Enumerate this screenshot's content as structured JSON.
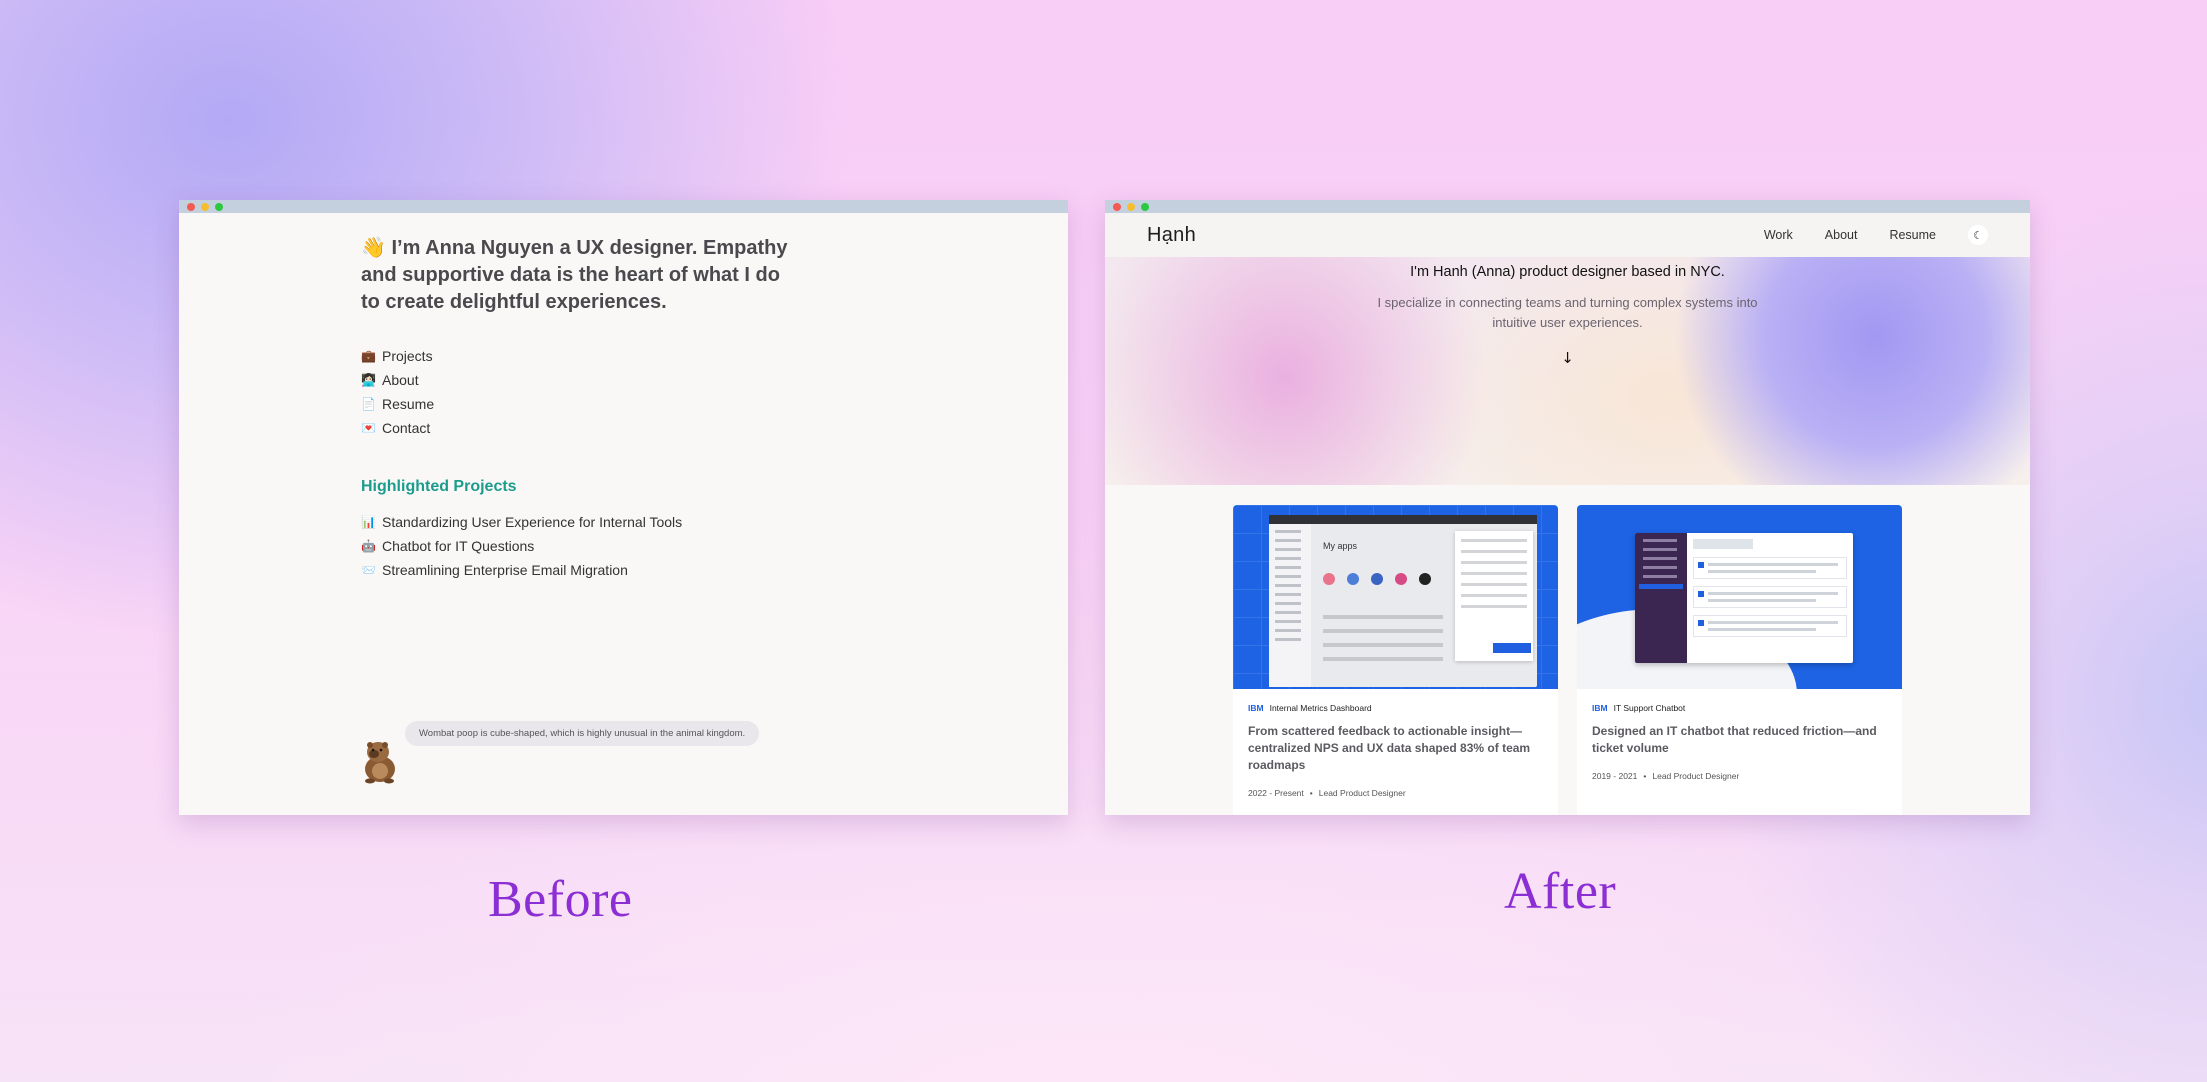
{
  "before": {
    "hero_emoji": "👋",
    "hero_text": "I’m Anna Nguyen a UX designer. Empathy and supportive data is the heart of what I do to create delightful experiences.",
    "nav": [
      {
        "emoji": "💼",
        "label": "Projects"
      },
      {
        "emoji": "👩🏻‍💻",
        "label": "About"
      },
      {
        "emoji": "📄",
        "label": "Resume"
      },
      {
        "emoji": "💌",
        "label": "Contact"
      }
    ],
    "section_title": "Highlighted Projects",
    "projects": [
      {
        "emoji": "📊",
        "label": "Standardizing User Experience for Internal Tools"
      },
      {
        "emoji": "🤖",
        "label": "Chatbot for IT Questions"
      },
      {
        "emoji": "📨",
        "label": "Streamlining Enterprise Email Migration"
      }
    ],
    "fun_fact": "Wombat poop is cube-shaped, which is highly unusual in the animal kingdom."
  },
  "after": {
    "brand": "Hạnh",
    "menu": [
      "Work",
      "About",
      "Resume"
    ],
    "theme_toggle_icon": "moon-icon",
    "hero_line1": "I'm Hanh (Anna) product designer based in NYC.",
    "hero_line2": "I specialize in connecting teams and turning complex systems into intuitive user experiences.",
    "scroll_arrow": "↓",
    "cards": [
      {
        "company": "IBM",
        "project": "Internal Metrics Dashboard",
        "title": "From scattered feedback to actionable insight—centralized NPS and UX data shaped 83% of team roadmaps",
        "years": "2022 - Present",
        "role": "Lead Product Designer",
        "thumb_heading": "My apps"
      },
      {
        "company": "IBM",
        "project": "IT Support Chatbot",
        "title": "Designed an IT chatbot that reduced friction—and ticket volume",
        "years": "2019 - 2021",
        "role": "Lead Product Designer"
      }
    ]
  },
  "captions": {
    "before": "Before",
    "after": "After"
  },
  "colors": {
    "accent_teal": "#1c9c8d",
    "caption_purple": "#8b2fd4",
    "ibm_blue": "#1f5fe0"
  }
}
